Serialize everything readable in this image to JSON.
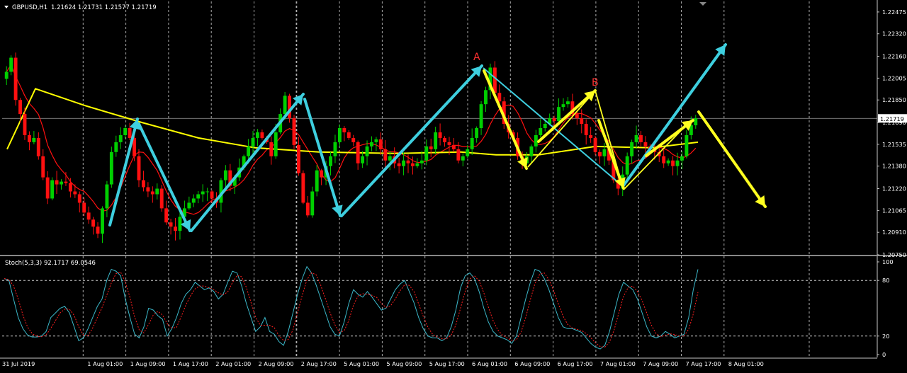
{
  "header": {
    "symbol_tf": "GBPUSD,H1",
    "ohlc": "1.21624 1.21731 1.21577 1.21719"
  },
  "indicator": {
    "label": "Stoch(5,3,3) 92.1717 69.0546"
  },
  "annotations": {
    "peak_a": "A",
    "peak_b": "B"
  },
  "colors": {
    "background": "#000000",
    "bull": "#00d000",
    "bear": "#ff1010",
    "ma_slow": "#ffff00",
    "ma_fast": "#ff1010",
    "wave_cyan": "#3ecfdf",
    "wave_yellow": "#ffff20",
    "stoch_main": "#3bb7c8",
    "stoch_signal": "#ff2020",
    "grid": "#c8c8c8",
    "axis_text": "#ffffff",
    "price_marker_bg": "#ffffff",
    "price_marker_text": "#000000",
    "annotation_text": "#ff3030"
  },
  "chart_data": [
    {
      "type": "candlestick",
      "symbol": "GBPUSD",
      "timeframe": "H1",
      "price_ticks": [
        "1.22475",
        "1.22320",
        "1.22160",
        "1.22005",
        "1.21850",
        "1.21690",
        "1.21535",
        "1.21380",
        "1.21220",
        "1.21065",
        "1.20910",
        "1.20750"
      ],
      "current_price": "1.21719",
      "time_labels": [
        "31 Jul 2019",
        "1 Aug 01:00",
        "1 Aug 09:00",
        "1 Aug 17:00",
        "2 Aug 01:00",
        "2 Aug 09:00",
        "2 Aug 17:00",
        "5 Aug 01:00",
        "5 Aug 09:00",
        "5 Aug 17:00",
        "6 Aug 01:00",
        "6 Aug 09:00",
        "6 Aug 17:00",
        "7 Aug 01:00",
        "7 Aug 09:00",
        "7 Aug 17:00",
        "8 Aug 01:00"
      ],
      "ylim": [
        1.2075,
        1.2255
      ],
      "closes": [
        1.2205,
        1.2215,
        1.2185,
        1.2175,
        1.216,
        1.2155,
        1.2158,
        1.2145,
        1.213,
        1.2115,
        1.2128,
        1.2125,
        1.2127,
        1.2126,
        1.212,
        1.2118,
        1.2112,
        1.2105,
        1.21,
        1.2095,
        1.209,
        1.2108,
        1.2125,
        1.2148,
        1.2155,
        1.216,
        1.2165,
        1.2158,
        1.2145,
        1.2128,
        1.2123,
        1.212,
        1.2118,
        1.2122,
        1.2108,
        1.2098,
        1.2095,
        1.2092,
        1.2102,
        1.2108,
        1.2112,
        1.2115,
        1.2118,
        1.212,
        1.212,
        1.2115,
        1.2112,
        1.2128,
        1.2135,
        1.2124,
        1.213,
        1.2137,
        1.2145,
        1.2152,
        1.2158,
        1.2162,
        1.2158,
        1.2155,
        1.2145,
        1.2162,
        1.2175,
        1.2188,
        1.2172,
        1.2153,
        1.2133,
        1.2112,
        1.2103,
        1.212,
        1.2135,
        1.213,
        1.2138,
        1.2145,
        1.2155,
        1.2165,
        1.2162,
        1.2158,
        1.2155,
        1.214,
        1.2145,
        1.2152,
        1.2155,
        1.2157,
        1.215,
        1.2142,
        1.2145,
        1.214,
        1.2138,
        1.2142,
        1.214,
        1.2138,
        1.214,
        1.2142,
        1.2152,
        1.215,
        1.2162,
        1.2158,
        1.2155,
        1.2153,
        1.215,
        1.2142,
        1.2145,
        1.215,
        1.2158,
        1.2165,
        1.2182,
        1.2192,
        1.2208,
        1.219,
        1.2184,
        1.2168,
        1.2162,
        1.2158,
        1.2145,
        1.214,
        1.2145,
        1.2152,
        1.216,
        1.2165,
        1.2168,
        1.2172,
        1.217,
        1.218,
        1.2182,
        1.2184,
        1.2175,
        1.2172,
        1.2168,
        1.216,
        1.2158,
        1.2148,
        1.2145,
        1.215,
        1.2142,
        1.2128,
        1.2122,
        1.2132,
        1.2145,
        1.2155,
        1.216,
        1.2155,
        1.2152,
        1.215,
        1.2148,
        1.2145,
        1.214,
        1.2142,
        1.2138,
        1.2142,
        1.2145,
        1.216,
        1.2167,
        1.2172
      ]
    },
    {
      "type": "line",
      "name": "Stoch(5,3,3)",
      "ylim": [
        0,
        100
      ],
      "levels": [
        "100",
        "80",
        "20",
        "0"
      ],
      "main": [
        82,
        80,
        60,
        40,
        28,
        21,
        19,
        19,
        20,
        25,
        40,
        45,
        50,
        52,
        45,
        30,
        15,
        18,
        28,
        40,
        52,
        60,
        80,
        92,
        90,
        85,
        60,
        40,
        22,
        18,
        30,
        50,
        48,
        42,
        38,
        20,
        28,
        40,
        55,
        65,
        70,
        78,
        74,
        70,
        72,
        68,
        60,
        65,
        78,
        90,
        88,
        74,
        55,
        40,
        25,
        30,
        40,
        25,
        22,
        14,
        10,
        25,
        45,
        65,
        82,
        95,
        88,
        75,
        60,
        45,
        30,
        22,
        20,
        35,
        55,
        70,
        65,
        62,
        68,
        62,
        55,
        48,
        50,
        60,
        70,
        76,
        80,
        68,
        56,
        40,
        28,
        20,
        18,
        18,
        15,
        18,
        30,
        48,
        72,
        85,
        88,
        82,
        68,
        50,
        35,
        25,
        20,
        18,
        16,
        12,
        20,
        40,
        60,
        78,
        92,
        90,
        82,
        70,
        55,
        40,
        30,
        28,
        28,
        26,
        24,
        18,
        12,
        8,
        6,
        10,
        25,
        45,
        65,
        78,
        74,
        70,
        60,
        45,
        30,
        20,
        18,
        20,
        25,
        22,
        18,
        20,
        22,
        40,
        70,
        92
      ]
    }
  ]
}
